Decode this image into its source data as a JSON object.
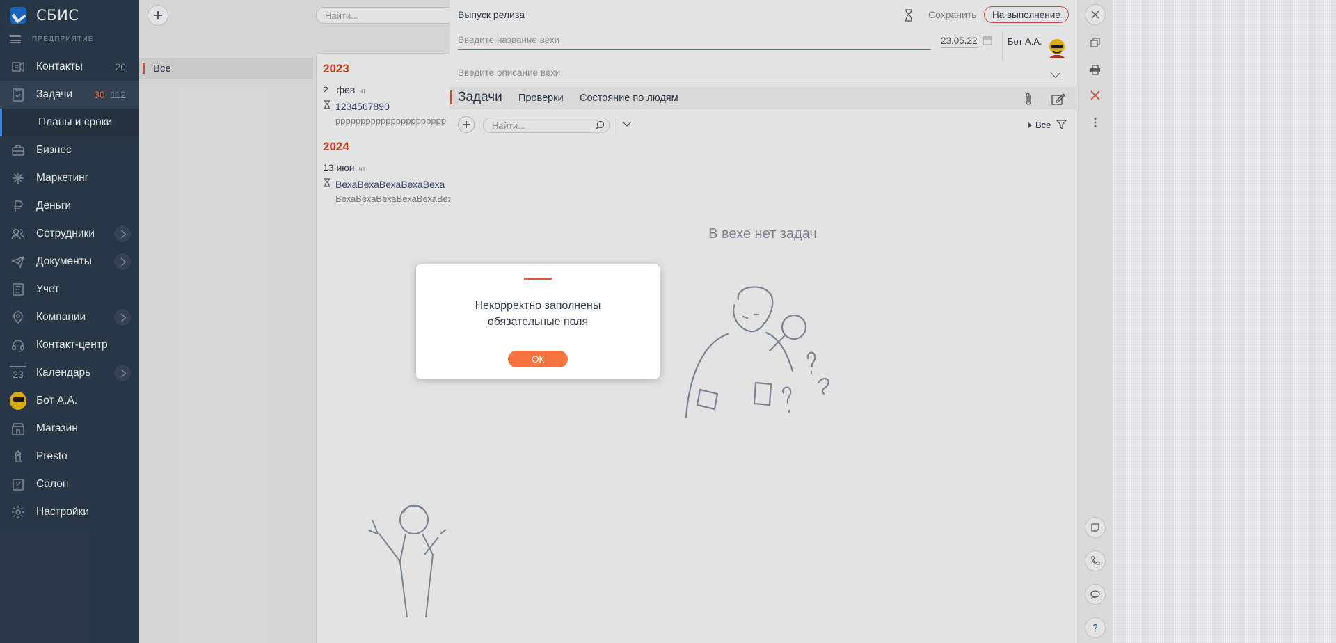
{
  "app": {
    "name": "СБИС",
    "org_label": "ПРЕДПРИЯТИЕ"
  },
  "nav": {
    "items": [
      {
        "label": "Контакты",
        "icon": "contacts-icon",
        "count": "20"
      },
      {
        "label": "Задачи",
        "icon": "tasks-icon",
        "count_hot": "30",
        "count": "112"
      },
      {
        "label": "Планы и сроки",
        "sub": true
      },
      {
        "label": "Бизнес",
        "icon": "briefcase-icon"
      },
      {
        "label": "Маркетинг",
        "icon": "marketing-icon"
      },
      {
        "label": "Деньги",
        "icon": "ruble-icon"
      },
      {
        "label": "Сотрудники",
        "icon": "people-icon",
        "arrow": true
      },
      {
        "label": "Документы",
        "icon": "paper-plane-icon",
        "arrow": true
      },
      {
        "label": "Учет",
        "icon": "calculator-icon"
      },
      {
        "label": "Компании",
        "icon": "map-pin-icon",
        "arrow": true
      },
      {
        "label": "Контакт-центр",
        "icon": "headset-icon"
      },
      {
        "label": "Календарь",
        "icon": "calendar-icon",
        "icon_text": "23",
        "arrow": true
      },
      {
        "label": "Бот А.А.",
        "icon": "avatar"
      },
      {
        "label": "Магазин",
        "icon": "shop-icon"
      },
      {
        "label": "Presto",
        "icon": "presto-icon"
      },
      {
        "label": "Салон",
        "icon": "salon-icon"
      },
      {
        "label": "Настройки",
        "icon": "gear-icon"
      }
    ]
  },
  "col1": {
    "filter_all": "Все"
  },
  "col2": {
    "search_placeholder": "Найти...",
    "groups": [
      {
        "year": "2023",
        "day": "2",
        "month": "фев",
        "weekday": "чт",
        "title": "1234567890",
        "subtitle": "рррррррррррррррррррррр"
      },
      {
        "year": "2024",
        "day": "13",
        "month": "июн",
        "weekday": "чт",
        "title": "ВехаВехаВехаВехаВеха",
        "subtitle": "ВехаВехаВехаВехаВехаВеха"
      }
    ]
  },
  "panel": {
    "header": "Выпуск релиза",
    "save": "Сохранить",
    "state": "На выполнение",
    "name_placeholder": "Введите название вехи",
    "date": "23.05.22",
    "owner": "Бот А.А.",
    "desc_placeholder": "Введите описание вехи",
    "tabs": {
      "main": "Задачи",
      "checks": "Проверки",
      "people": "Состояние по людям"
    },
    "search_placeholder": "Найти...",
    "filter_all": "Все",
    "empty": "В вехе нет задач"
  },
  "dialog": {
    "message_line1": "Некорректно заполнены",
    "message_line2": "обязательные поля",
    "ok": "ОК"
  },
  "colors": {
    "nav_bg": "#2E3E4F",
    "accent_red": "#E6534A",
    "accent_orange": "#F57440",
    "year_color": "#E1481C",
    "hot_count": "#FF7A45"
  }
}
